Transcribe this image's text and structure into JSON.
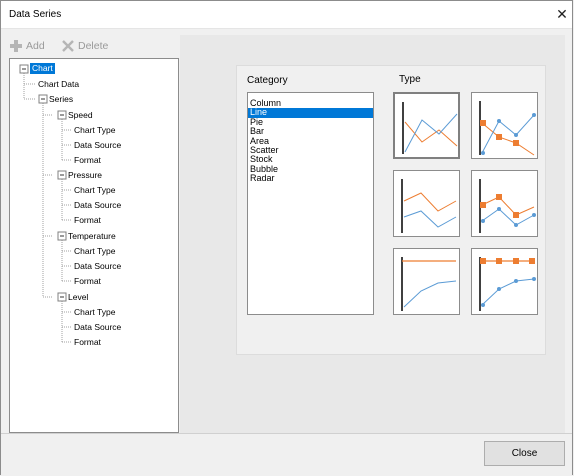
{
  "window": {
    "title": "Data Series",
    "close_glyph": "✕"
  },
  "toolbar": {
    "add_label": "Add",
    "delete_label": "Delete"
  },
  "tree": {
    "root": "Chart",
    "chart_data": "Chart Data",
    "series": "Series",
    "series_items": [
      {
        "name": "Speed",
        "children": [
          "Chart Type",
          "Data Source",
          "Format"
        ]
      },
      {
        "name": "Pressure",
        "children": [
          "Chart Type",
          "Data Source",
          "Format"
        ]
      },
      {
        "name": "Temperature",
        "children": [
          "Chart Type",
          "Data Source",
          "Format"
        ]
      },
      {
        "name": "Level",
        "children": [
          "Chart Type",
          "Data Source",
          "Format"
        ]
      }
    ]
  },
  "panel": {
    "category_label": "Category",
    "type_label": "Type",
    "categories": [
      "Column",
      "Line",
      "Pie",
      "Bar",
      "Area",
      "Scatter",
      "Stock",
      "Bubble",
      "Radar"
    ],
    "selected_category": "Line"
  },
  "footer": {
    "close_label": "Close"
  },
  "colors": {
    "selection": "#0078d7",
    "series_orange": "#ed7d31",
    "series_blue": "#5b9bd5"
  }
}
